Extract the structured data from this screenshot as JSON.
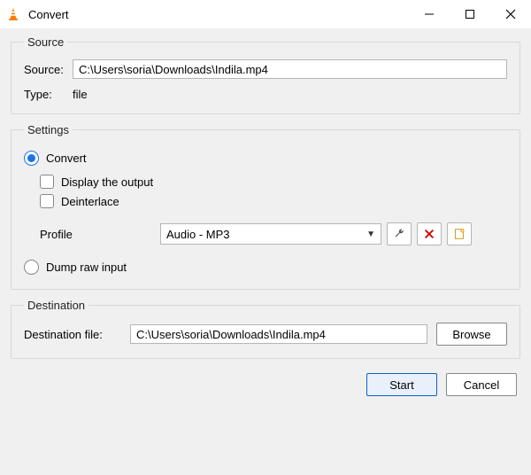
{
  "window": {
    "title": "Convert"
  },
  "source": {
    "legend": "Source",
    "source_label": "Source:",
    "source_value": "C:\\Users\\soria\\Downloads\\Indila.mp4",
    "type_label": "Type:",
    "type_value": "file"
  },
  "settings": {
    "legend": "Settings",
    "convert_label": "Convert",
    "display_output_label": "Display the output",
    "deinterlace_label": "Deinterlace",
    "profile_label": "Profile",
    "profile_value": "Audio - MP3",
    "dump_label": "Dump raw input"
  },
  "destination": {
    "legend": "Destination",
    "file_label": "Destination file:",
    "file_value": "C:\\Users\\soria\\Downloads\\Indila.mp4",
    "browse_label": "Browse"
  },
  "footer": {
    "start_label": "Start",
    "cancel_label": "Cancel"
  }
}
